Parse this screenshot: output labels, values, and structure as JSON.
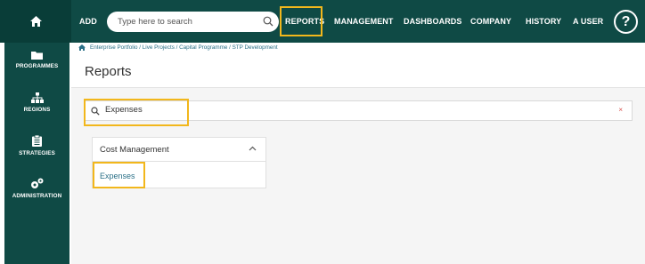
{
  "topnav": {
    "add_label": "ADD",
    "search_placeholder": "Type here to search",
    "items": [
      "REPORTS",
      "MANAGEMENT",
      "DASHBOARDS",
      "COMPANY",
      "HISTORY",
      "A USER"
    ],
    "help_label": "?"
  },
  "sidebar": {
    "items": [
      {
        "label": "PROGRAMMES",
        "icon": "folder-icon"
      },
      {
        "label": "REGIONS",
        "icon": "sitemap-icon"
      },
      {
        "label": "STRATEGIES",
        "icon": "clipboard-icon"
      },
      {
        "label": "ADMINISTRATION",
        "icon": "gears-icon"
      }
    ]
  },
  "breadcrumb": "Enterprise Portfolio / Live Projects / Capital Programme / STP Development",
  "page_title": "Reports",
  "report_search": {
    "value": "Expenses",
    "clear_label": "×"
  },
  "panel": {
    "header": "Cost Management",
    "items": [
      "Expenses"
    ]
  },
  "colors": {
    "nav_bg": "#0f4a45",
    "highlight": "#f2b71c",
    "link": "#2a6f86"
  }
}
